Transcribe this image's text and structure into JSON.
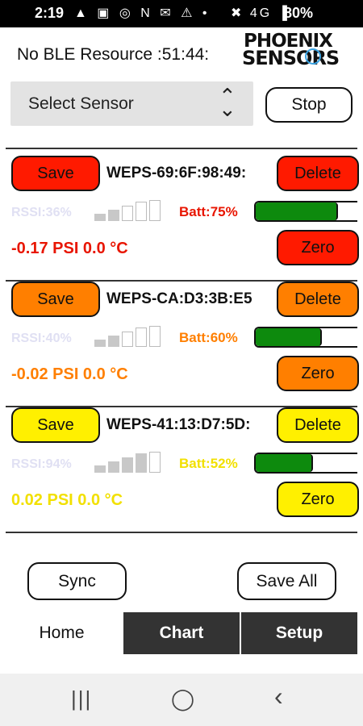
{
  "status_bar": {
    "time": "2:19",
    "icons": "▲ ▣ ◎ N ✉ ⚠ •",
    "right": "✖ 4G ▐",
    "battery": "80%"
  },
  "header": {
    "ble_status": "No BLE Resource :51:44:",
    "logo_line1": "PHOENIX",
    "logo_line2": "SENSORS"
  },
  "controls": {
    "select_label": "Select Sensor",
    "select_icon": "⌃⌄",
    "stop_label": "Stop"
  },
  "sensors": [
    {
      "save": "Save",
      "name": "WEPS-69:6F:98:49:",
      "delete": "Delete",
      "rssi": "RSSI:36%",
      "rssi_bars": 2,
      "batt": "Batt:75%",
      "batt_level": 0.75,
      "reading": "-0.17 PSI  0.0 °C",
      "zero": "Zero",
      "color": "#ff1a00",
      "text_color": "#e81500"
    },
    {
      "save": "Save",
      "name": "WEPS-CA:D3:3B:E5",
      "delete": "Delete",
      "rssi": "RSSI:40%",
      "rssi_bars": 2,
      "batt": "Batt:60%",
      "batt_level": 0.6,
      "reading": "-0.02 PSI  0.0 °C",
      "zero": "Zero",
      "color": "#ff7f00",
      "text_color": "#ff7f00"
    },
    {
      "save": "Save",
      "name": "WEPS-41:13:D7:5D:",
      "delete": "Delete",
      "rssi": "RSSI:94%",
      "rssi_bars": 4,
      "batt": "Batt:52%",
      "batt_level": 0.52,
      "reading": "0.02 PSI  0.0 °C",
      "zero": "Zero",
      "color": "#fff000",
      "text_color": "#f2e000"
    }
  ],
  "footer": {
    "sync_label": "Sync",
    "save_all_label": "Save All"
  },
  "tabs": [
    {
      "label": "Home"
    },
    {
      "label": "Chart"
    },
    {
      "label": "Setup"
    }
  ],
  "nav": {
    "recents": "|||",
    "home": "◯",
    "back": "‹"
  }
}
